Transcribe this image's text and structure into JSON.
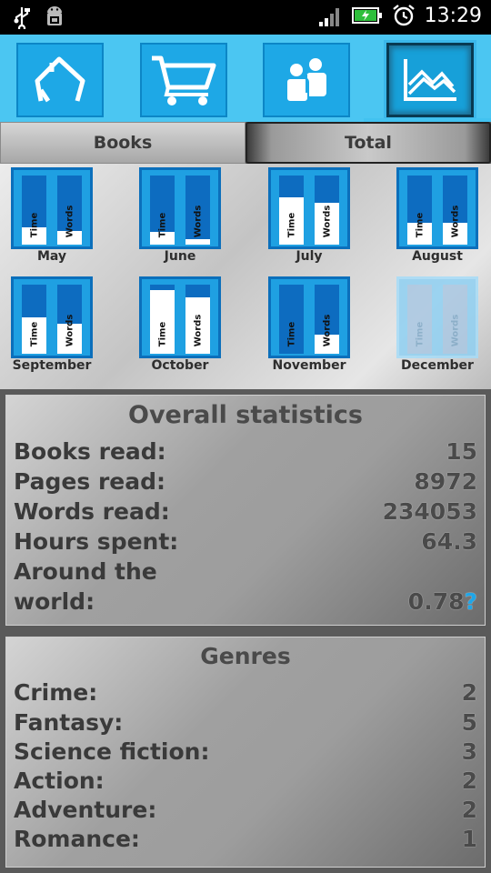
{
  "status_bar": {
    "time": "13:29",
    "icons": [
      "usb-icon",
      "android-debug-icon",
      "signal-icon",
      "battery-charging-icon",
      "alarm-icon"
    ]
  },
  "nav": {
    "items": [
      {
        "name": "home-icon",
        "active": false
      },
      {
        "name": "cart-icon",
        "active": false
      },
      {
        "name": "people-icon",
        "active": false
      },
      {
        "name": "stats-chart-icon",
        "active": true
      }
    ],
    "accent_color": "#4bc6f2"
  },
  "tabs": {
    "books": "Books",
    "total": "Total"
  },
  "months": [
    {
      "label": "May",
      "time": 0.25,
      "words": 0.2,
      "faded": false
    },
    {
      "label": "June",
      "time": 0.18,
      "words": 0.08,
      "faded": false
    },
    {
      "label": "July",
      "time": 0.68,
      "words": 0.6,
      "faded": false
    },
    {
      "label": "August",
      "time": 0.32,
      "words": 0.32,
      "faded": false
    },
    {
      "label": "September",
      "time": 0.52,
      "words": 0.44,
      "faded": false
    },
    {
      "label": "October",
      "time": 0.92,
      "words": 0.82,
      "faded": false
    },
    {
      "label": "November",
      "time": 0.0,
      "words": 0.28,
      "faded": false
    },
    {
      "label": "December",
      "time": 0.0,
      "words": 0.0,
      "faded": true
    }
  ],
  "bar_labels": {
    "time": "Time",
    "words": "Words"
  },
  "overall": {
    "title": "Overall statistics",
    "rows": [
      {
        "label": "Books read:",
        "value": "15"
      },
      {
        "label": "Pages read:",
        "value": "8972"
      },
      {
        "label": "Words read:",
        "value": "234053"
      },
      {
        "label": "Hours spent:",
        "value": "64.3"
      }
    ],
    "around_label_1": "Around the",
    "around_label_2": "world:",
    "around_value": "0.78",
    "around_help": "?"
  },
  "genres": {
    "title": "Genres",
    "rows": [
      {
        "label": "Crime:",
        "value": "2"
      },
      {
        "label": "Fantasy:",
        "value": "5"
      },
      {
        "label": "Science fiction:",
        "value": "3"
      },
      {
        "label": "Action:",
        "value": "2"
      },
      {
        "label": "Adventure:",
        "value": "2"
      },
      {
        "label": "Romance:",
        "value": "1"
      }
    ]
  }
}
